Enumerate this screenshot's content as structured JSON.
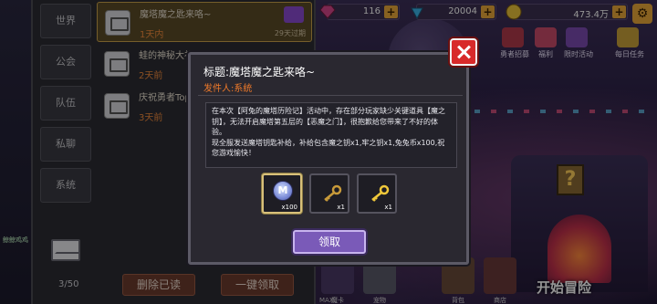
{
  "resources": [
    {
      "name": "hearts",
      "value": "116",
      "icon": "heart-gem-icon",
      "color": "#d4468a"
    },
    {
      "name": "gems",
      "value": "20004",
      "icon": "diamond-icon",
      "color": "#3ab4e8"
    },
    {
      "name": "coins",
      "value": "473.4万",
      "icon": "coin-icon",
      "color": "#e8c23a"
    }
  ],
  "feature_icons": [
    "勇者招募",
    "福利",
    "限时活动",
    "每日任务"
  ],
  "mail": {
    "categories": [
      "世界",
      "公会",
      "队伍",
      "私聊",
      "系统"
    ],
    "items": [
      {
        "title": "魔塔魔之匙来咯~",
        "time": "1天内",
        "expire": "29天过期",
        "selected": true
      },
      {
        "title": "蛙的神秘大礼",
        "time": "2天前",
        "expire": "",
        "selected": false
      },
      {
        "title": "庆祝勇者Top",
        "time": "3天前",
        "expire": "",
        "selected": false
      }
    ],
    "count": "3/50",
    "delete_read_label": "删除已读",
    "claim_all_label": "一键领取"
  },
  "left_label": "鲸鲸鸡鸡",
  "dock": [
    "魔卡",
    "宠物",
    "背包",
    "商店"
  ],
  "start_label": "开始冒险",
  "max_label": "MAX",
  "dialog": {
    "title": "标题:魔塔魔之匙来咯~",
    "sender": "发件人:系统",
    "body": "在本次【阿兔的魔塔历险记】活动中，存在部分玩家缺少关键道具【魔之钥】，无法开启魔塔第五层的【恶魔之门】，很抱歉给您带来了不好的体验。\n现全服发送魔塔钥匙补给，补给包含魔之钥x1,牢之钥x1,兔兔币x100,祝您游戏愉快！",
    "rewards": [
      {
        "name": "兔兔币",
        "icon": "bunny-coin-icon",
        "qty": "x100"
      },
      {
        "name": "牢之钥",
        "icon": "key-icon",
        "qty": "x1"
      },
      {
        "name": "魔之钥",
        "icon": "golden-key-icon",
        "qty": "x1"
      }
    ],
    "claim_label": "领取"
  }
}
